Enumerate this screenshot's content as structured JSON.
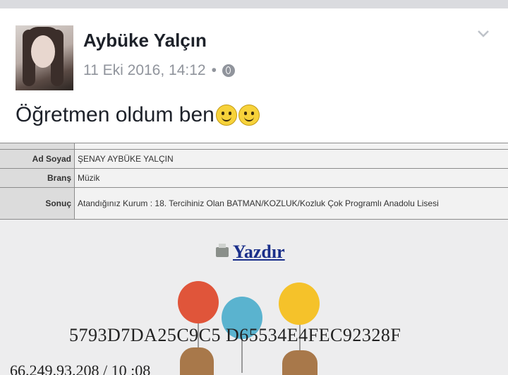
{
  "post": {
    "author": "Aybüke Yalçın",
    "timestamp": "11 Eki 2016, 14:12",
    "separator": "•",
    "text": "Öğretmen oldum ben",
    "emojis": [
      "smiley-icon",
      "smiley-icon"
    ],
    "privacy_icon": "globe-icon",
    "menu_icon": "chevron-down-icon"
  },
  "result_table": {
    "rows": [
      {
        "label": "Ad Soyad",
        "value": "ŞENAY AYBÜKE YALÇIN"
      },
      {
        "label": "Branş",
        "value": "Müzik"
      },
      {
        "label": "Sonuç",
        "value": "Atandığınız Kurum : 18. Tercihiniz Olan BATMAN/KOZLUK/Kozluk Çok Programlı Anadolu Lisesi"
      }
    ]
  },
  "print_link": {
    "label": "Yazdır",
    "icon": "printer-icon"
  },
  "hash_code": "5793D7DA25C9C5 D65534E4FEC92328F",
  "ip_line": "66.249.93.208 / 10 :08",
  "colors": {
    "balloon_red": "#e0553a",
    "balloon_blue": "#5ab3cf",
    "balloon_yellow": "#f5c22a",
    "link_blue": "#1a2f8a"
  }
}
